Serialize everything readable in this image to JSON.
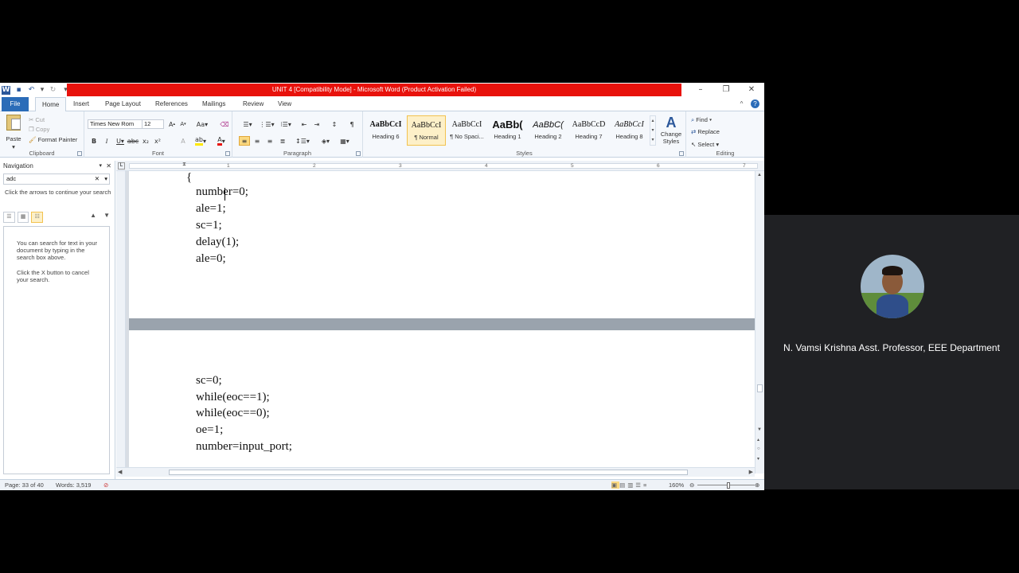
{
  "window": {
    "title": "UNIT 4 [Compatibility Mode] - Microsoft Word (Product Activation Failed)",
    "title_bar_color": "#e8120c"
  },
  "tabs": [
    "File",
    "Home",
    "Insert",
    "Page Layout",
    "References",
    "Mailings",
    "Review",
    "View"
  ],
  "active_tab": "Home",
  "clipboard": {
    "paste": "Paste",
    "cut": "Cut",
    "copy": "Copy",
    "format_painter": "Format Painter",
    "label": "Clipboard"
  },
  "font": {
    "name": "Times New Rom",
    "size": "12",
    "label": "Font"
  },
  "paragraph": {
    "label": "Paragraph"
  },
  "styles": {
    "label": "Styles",
    "items": [
      {
        "sample": "AaBbCcI",
        "name": "Heading 6"
      },
      {
        "sample": "AaBbCcI",
        "name": "¶ Normal"
      },
      {
        "sample": "AaBbCcI",
        "name": "¶ No Spaci..."
      },
      {
        "sample": "AaBb(",
        "name": "Heading 1"
      },
      {
        "sample": "AaBbC(",
        "name": "Heading 2"
      },
      {
        "sample": "AaBbCcD",
        "name": "Heading 7"
      },
      {
        "sample": "AaBbCcI",
        "name": "Heading 8"
      }
    ],
    "change_styles": "Change Styles"
  },
  "editing": {
    "label": "Editing",
    "find": "Find",
    "replace": "Replace",
    "select": "Select"
  },
  "navigation": {
    "title": "Navigation",
    "search_value": "adc",
    "hint": "Click the arrows to continue your search",
    "help_1": "You can search for text in your document by typing in the search box above.",
    "help_2": "Click the X button to cancel your search."
  },
  "ruler_numbers": [
    "1",
    "2",
    "3",
    "4",
    "5",
    "6",
    "7"
  ],
  "document": {
    "page1_lines": [
      "{",
      "number=0;",
      "ale=1;",
      "sc=1;",
      "delay(1);",
      "ale=0;"
    ],
    "page2_lines": [
      "sc=0;",
      "while(eoc==1);",
      "while(eoc==0);",
      "oe=1;",
      "number=input_port;"
    ]
  },
  "status": {
    "page": "Page: 33 of 40",
    "words": "Words: 3,519",
    "zoom": "160%"
  },
  "presenter": {
    "name": "N. Vamsi Krishna Asst. Professor, EEE Department"
  }
}
